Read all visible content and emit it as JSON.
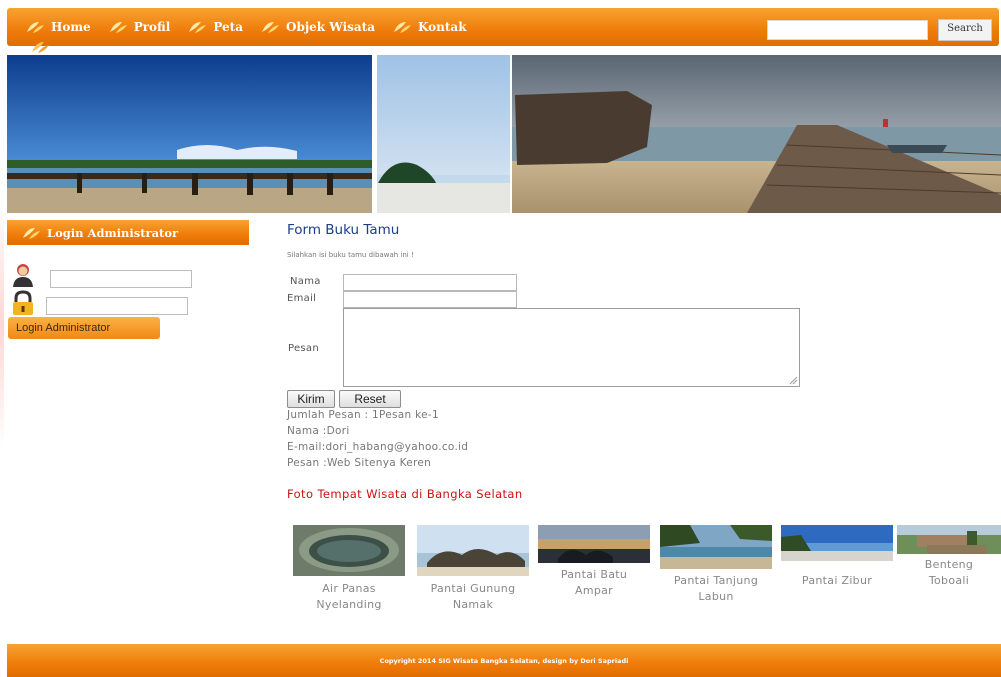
{
  "nav": {
    "items": [
      {
        "label": "Home"
      },
      {
        "label": "Profil"
      },
      {
        "label": "Peta"
      },
      {
        "label": "Objek Wisata"
      },
      {
        "label": "Kontak"
      }
    ],
    "search_button": "Search",
    "search_value": ""
  },
  "sidebar": {
    "heading": "Login Administrator",
    "username_value": "",
    "password_value": "",
    "login_button": "Login Administrator"
  },
  "form": {
    "title": "Form Buku Tamu",
    "instruction": "Silahkan isi buku tamu dibawah ini !",
    "name_label": "Nama",
    "email_label": "Email",
    "message_label": "Pesan",
    "submit_label": "Kirim",
    "reset_label": "Reset"
  },
  "messages": {
    "count_line": "Jumlah Pesan : 1Pesan ke-1",
    "name_line": "Nama :Dori",
    "email_line": "E-mail:dori_habang@yahoo.co.id",
    "message_line": "Pesan :Web Sitenya Keren"
  },
  "photos": {
    "heading": "Foto Tempat Wisata di Bangka Selatan",
    "items": [
      {
        "caption_1": "Air Panas",
        "caption_2": "Nyelanding"
      },
      {
        "caption_1": "Pantai Gunung",
        "caption_2": "Namak"
      },
      {
        "caption_1": "Pantai Batu",
        "caption_2": "Ampar"
      },
      {
        "caption_1": "Pantai Tanjung",
        "caption_2": "Labun"
      },
      {
        "caption_1": "Pantai Zibur",
        "caption_2": ""
      },
      {
        "caption_1": "Benteng",
        "caption_2": "Toboali"
      }
    ]
  },
  "footer": {
    "text": "Copyright 2014 SIG Wisata Bangka Selatan, design by Dori Sapriadi"
  },
  "colors": {
    "accent": "#ef7b0a",
    "title_blue": "#1a3d8f",
    "heading_red": "#cc1111"
  }
}
